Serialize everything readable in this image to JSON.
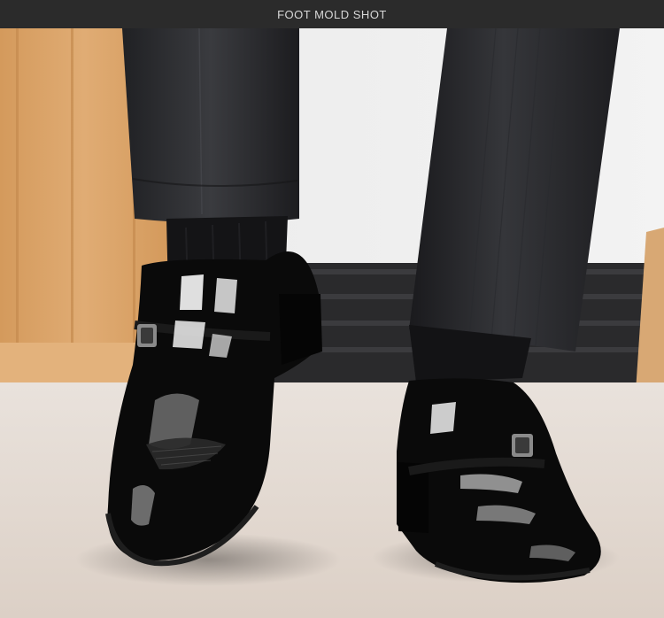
{
  "header": {
    "title": "FOOT MOLD SHOT"
  },
  "photo": {
    "subject": "man-wearing-black-patent-leather-loafers",
    "colors": {
      "header_bg": "#2b2b2b",
      "wood_panel": "#d9a46a",
      "wall": "#eeeeee",
      "floor": "#e7ddd6",
      "trousers": "#2c2d30",
      "shoe": "#0a0a0a"
    }
  }
}
